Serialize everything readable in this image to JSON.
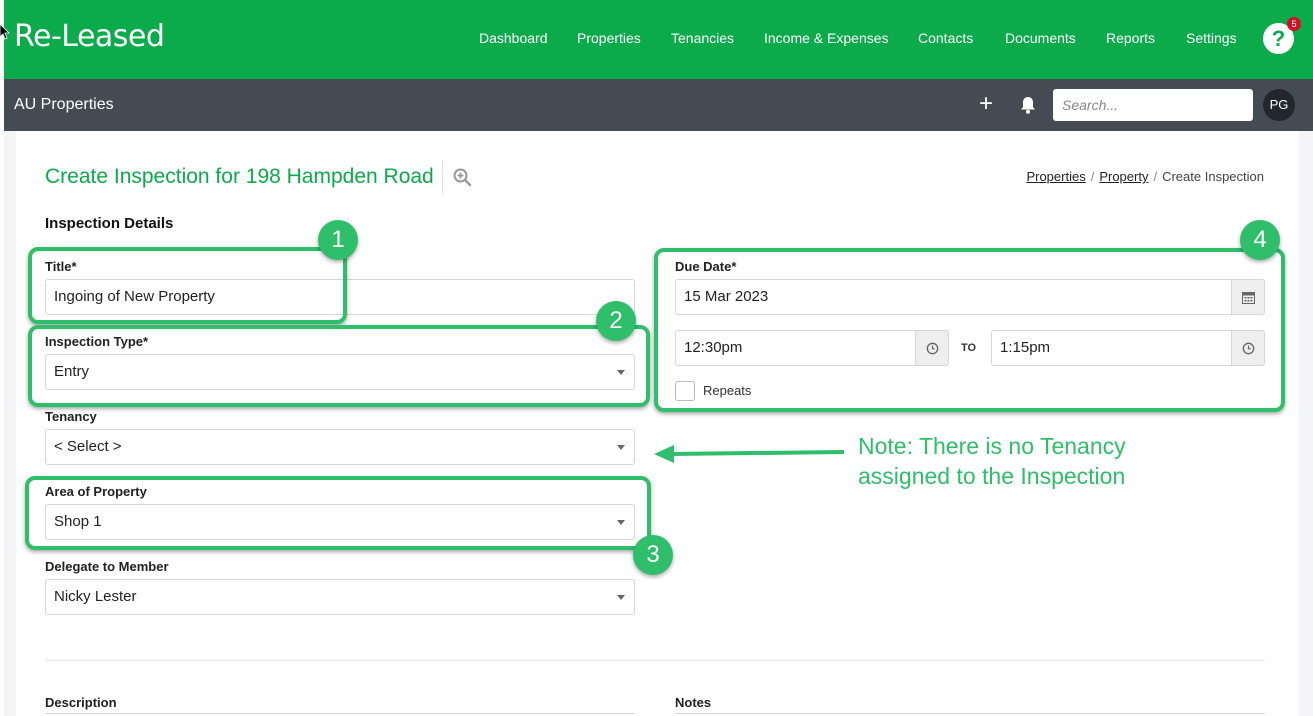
{
  "app": {
    "logo": "Re-Leased",
    "nav": [
      {
        "label": "Dashboard"
      },
      {
        "label": "Properties"
      },
      {
        "label": "Tenancies"
      },
      {
        "label": "Income & Expenses"
      },
      {
        "label": "Contacts"
      },
      {
        "label": "Documents"
      },
      {
        "label": "Reports"
      },
      {
        "label": "Settings"
      }
    ],
    "help_label": "?",
    "help_badge": "5"
  },
  "subbar": {
    "account": "AU Properties",
    "plus": "+",
    "search_placeholder": "Search...",
    "avatar": "PG"
  },
  "page": {
    "title": "Create Inspection for 198 Hampden Road",
    "breadcrumb": [
      {
        "label": "Properties"
      },
      {
        "label": "Property"
      },
      {
        "label": "Create Inspection"
      }
    ],
    "breadcrumb_sep": "/",
    "section_title": "Inspection Details"
  },
  "form": {
    "title": {
      "label": "Title*",
      "value": "Ingoing of New Property"
    },
    "inspection_type": {
      "label": "Inspection Type*",
      "value": "Entry"
    },
    "tenancy": {
      "label": "Tenancy",
      "value": "< Select >"
    },
    "area": {
      "label": "Area of Property",
      "value": "Shop 1"
    },
    "delegate": {
      "label": "Delegate to Member",
      "value": "Nicky Lester"
    },
    "due_date": {
      "label": "Due Date*",
      "value": "15 Mar 2023"
    },
    "start_time": "12:30pm",
    "to_label": "TO",
    "end_time": "1:15pm",
    "repeats_label": "Repeats",
    "description_label": "Description",
    "notes_label": "Notes"
  },
  "annotations": {
    "badges": [
      "1",
      "2",
      "3",
      "4"
    ],
    "note": "Note: There is no Tenancy assigned to the Inspection",
    "color": "#2fbe6a"
  },
  "colors": {
    "brand_green": "#0bab4b",
    "subbar": "#444b52",
    "badge_red": "#d3102b"
  }
}
